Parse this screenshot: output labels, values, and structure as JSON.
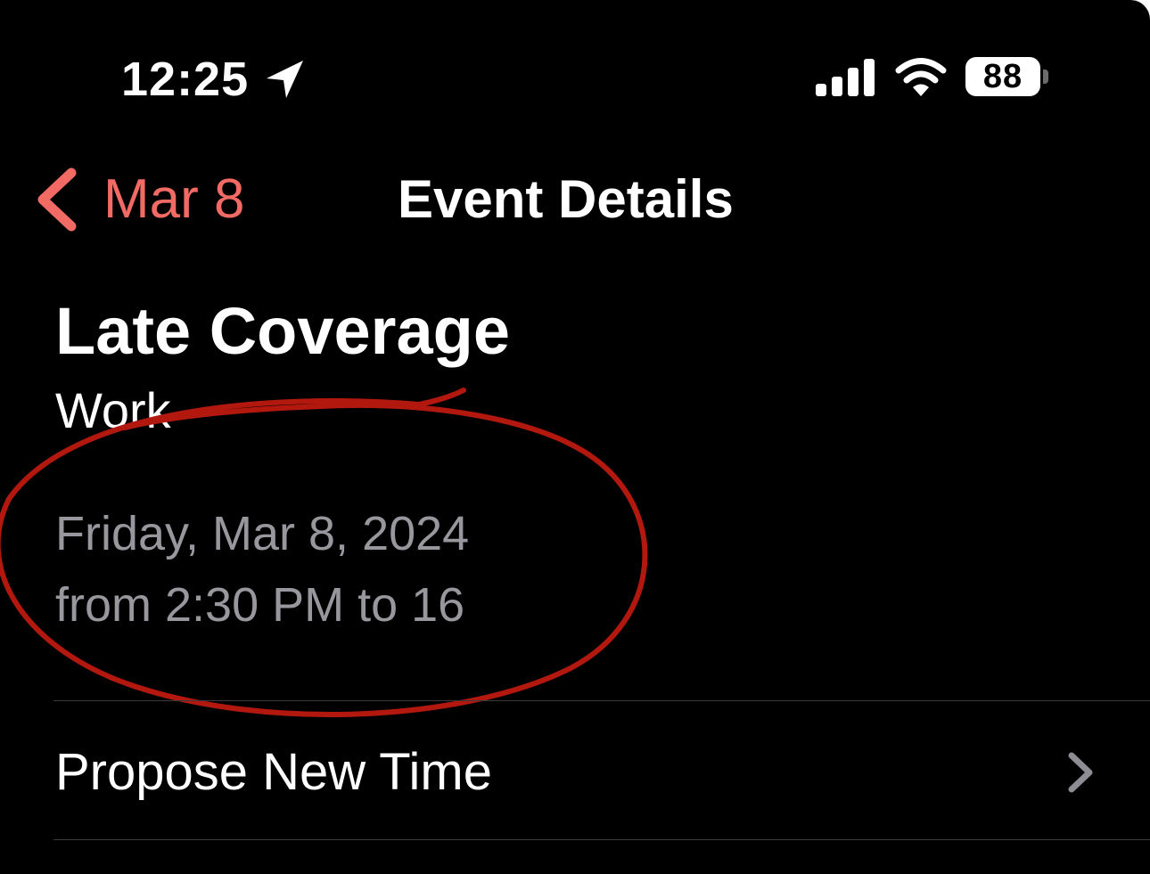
{
  "status_bar": {
    "time": "12:25",
    "battery_level": "88"
  },
  "nav": {
    "back_label": "Mar 8",
    "title": "Event Details"
  },
  "event": {
    "title": "Late Coverage",
    "calendar": "Work",
    "date": "Friday, Mar 8, 2024",
    "time": "from 2:30 PM to 16"
  },
  "actions": {
    "propose_new_time": "Propose New Time"
  },
  "colors": {
    "accent": "#f26a64",
    "secondary_text": "#98979d",
    "annotation": "#b3180f"
  },
  "icons": [
    "location-arrow-icon",
    "cellular-signal-icon",
    "wifi-icon",
    "battery-icon",
    "chevron-left-icon",
    "chevron-right-icon"
  ]
}
